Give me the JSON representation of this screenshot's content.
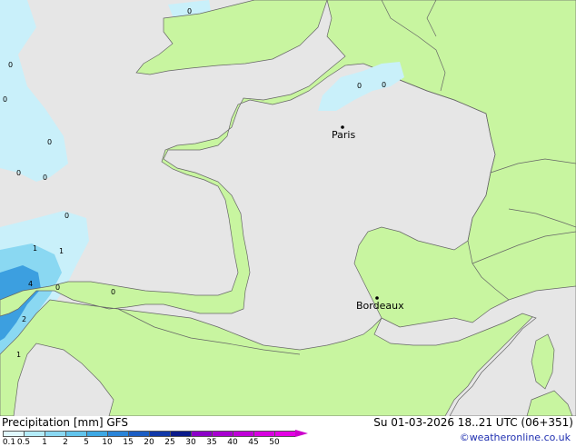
{
  "map": {
    "cities": [
      {
        "id": "paris",
        "name": "Paris"
      },
      {
        "id": "bordeaux",
        "name": "Bordeaux"
      }
    ],
    "contour_labels": [
      "0",
      "0",
      "0",
      "0",
      "0",
      "0",
      "0",
      "0",
      "0",
      "1",
      "1",
      "4",
      "0",
      "0",
      "2",
      "1"
    ],
    "colors": {
      "sea": "#e6e6e6",
      "land": "#c8f5a0",
      "precip_light": "#c9f0fa",
      "precip_mid": "#8ad8f2",
      "precip_heavy": "#3c9fe0"
    }
  },
  "footer": {
    "title": "Precipitation [mm] GFS",
    "datetime": "Su 01-03-2026 18..21 UTC (06+351)",
    "credit": "©weatheronline.co.uk",
    "legend": {
      "labels": [
        "0.1",
        "0.5",
        "1",
        "2",
        "5",
        "10",
        "15",
        "20",
        "25",
        "30",
        "35",
        "40",
        "45",
        "50"
      ],
      "colors": [
        "#e0f8fd",
        "#b4ecf9",
        "#8ad8f2",
        "#62c4ec",
        "#3ea8e4",
        "#2a84d8",
        "#1c5ec4",
        "#1038a8",
        "#0a1a8a",
        "#8c00c8",
        "#a800d0",
        "#c000d8",
        "#d800e0",
        "#e400e4"
      ]
    }
  }
}
